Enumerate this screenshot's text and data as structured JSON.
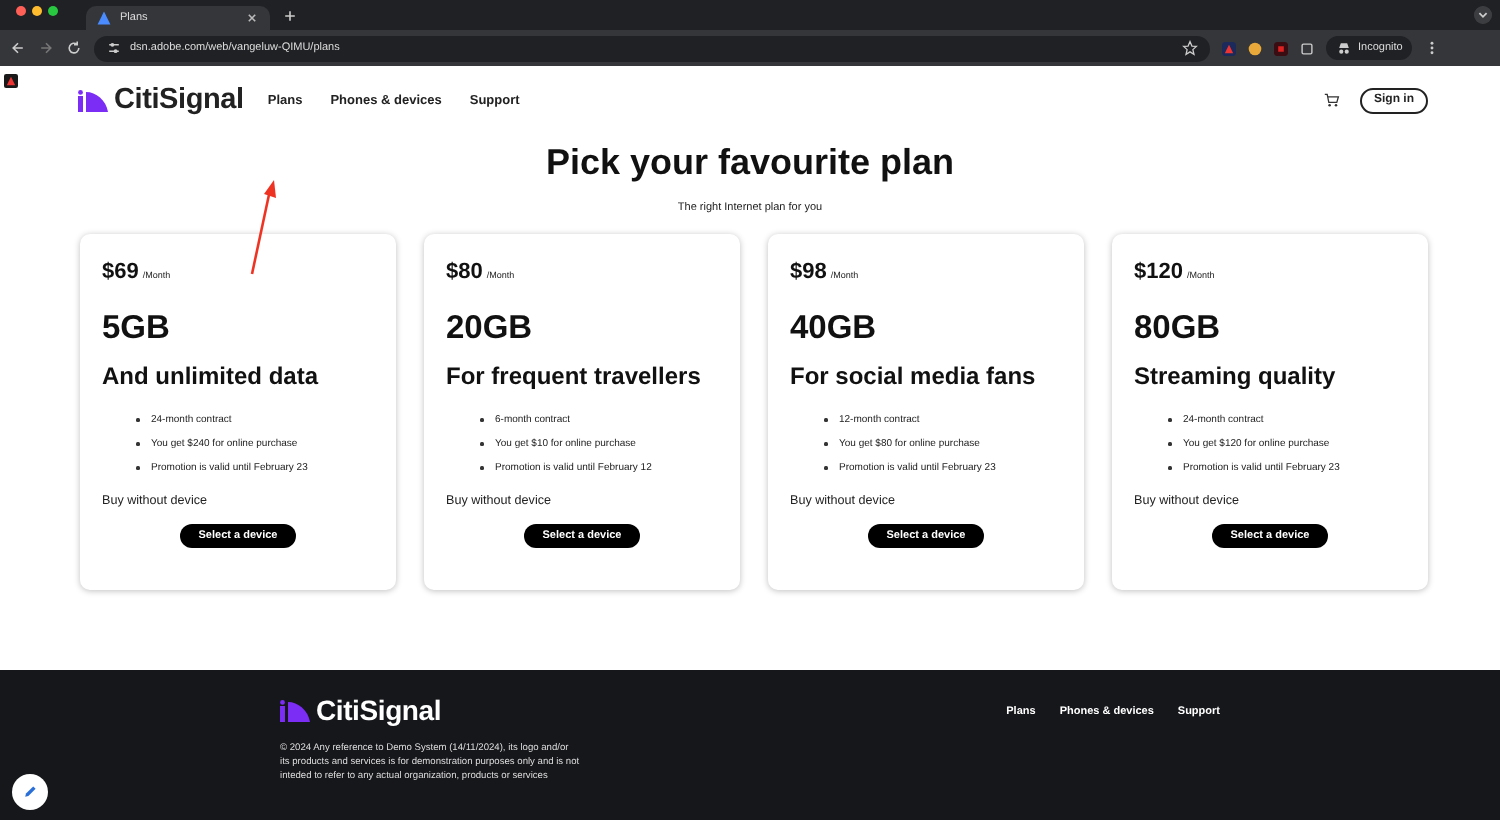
{
  "browser": {
    "tab_title": "Plans",
    "url": "dsn.adobe.com/web/vangeluw-QIMU/plans",
    "incognito_label": "Incognito"
  },
  "header": {
    "logo": "CitiSignal",
    "nav": [
      "Plans",
      "Phones & devices",
      "Support"
    ],
    "sign_in": "Sign in"
  },
  "hero": {
    "title": "Pick your favourite plan",
    "subtitle": "The right Internet plan for you"
  },
  "plans": [
    {
      "price": "$69",
      "period": "/Month",
      "data": "5GB",
      "tagline": "And unlimited data",
      "features": [
        "24-month contract",
        "You get $240 for online purchase",
        "Promotion is valid until February 23"
      ],
      "link": "Buy without device",
      "button": "Select a device"
    },
    {
      "price": "$80",
      "period": "/Month",
      "data": "20GB",
      "tagline": "For frequent travellers",
      "features": [
        "6-month contract",
        "You get $10 for online purchase",
        "Promotion is valid until February 12"
      ],
      "link": "Buy without device",
      "button": "Select a device"
    },
    {
      "price": "$98",
      "period": "/Month",
      "data": "40GB",
      "tagline": "For social media fans",
      "features": [
        "12-month contract",
        "You get $80 for online purchase",
        "Promotion is valid until February 23"
      ],
      "link": "Buy without device",
      "button": "Select a device"
    },
    {
      "price": "$120",
      "period": "/Month",
      "data": "80GB",
      "tagline": "Streaming quality",
      "features": [
        "24-month contract",
        "You get $120 for online purchase",
        "Promotion is valid until February 23"
      ],
      "link": "Buy without device",
      "button": "Select a device"
    }
  ],
  "footer": {
    "logo": "CitiSignal",
    "links": [
      "Plans",
      "Phones & devices",
      "Support"
    ],
    "legal": "© 2024 Any reference to Demo System (14/11/2024), its logo and/or its products and services is for demonstration purposes only and is not inteded to refer to any actual organization, products or services"
  }
}
